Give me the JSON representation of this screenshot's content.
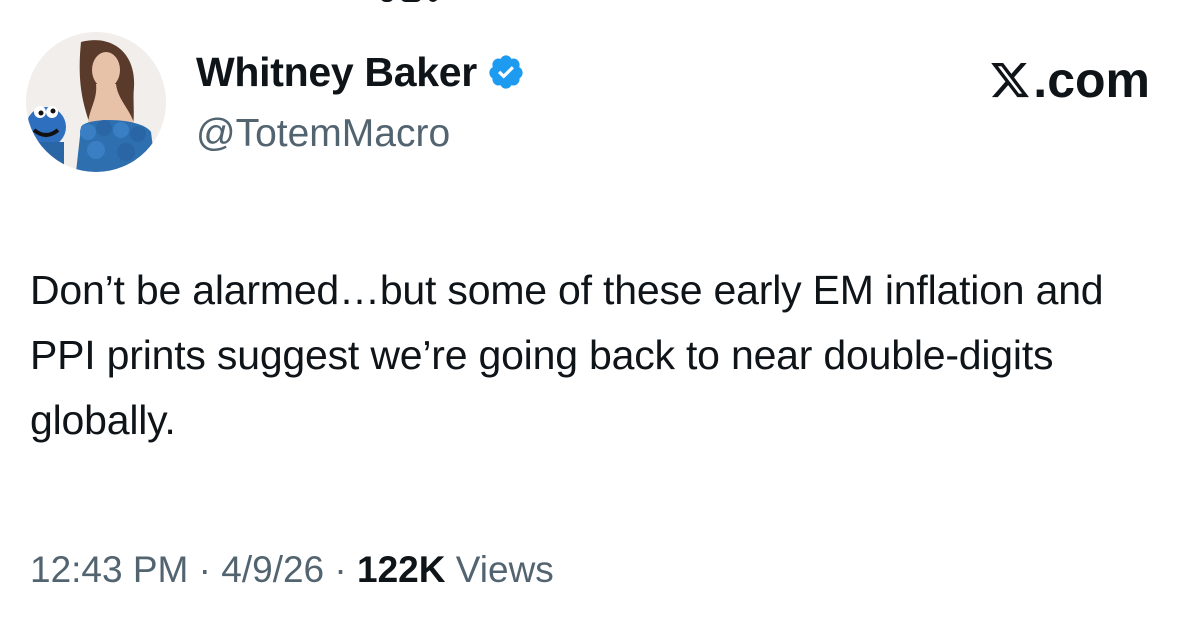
{
  "author": {
    "display_name": "Whitney Baker",
    "handle": "@TotemMacro",
    "verified": true,
    "verified_color": "#1d9bf0"
  },
  "brand": {
    "label": ".com",
    "logo_icon": "x-logo-icon"
  },
  "tweet": {
    "text": "Don’t be alarmed…but some of these early EM inflation and PPI prints suggest we’re going back to near double-digits globally."
  },
  "meta": {
    "time": "12:43 PM",
    "separator": "·",
    "date": "4/9/26",
    "views_count": "122K",
    "views_label": "Views"
  },
  "colors": {
    "text": "#0f1419",
    "secondary": "#536471",
    "background": "#ffffff"
  }
}
